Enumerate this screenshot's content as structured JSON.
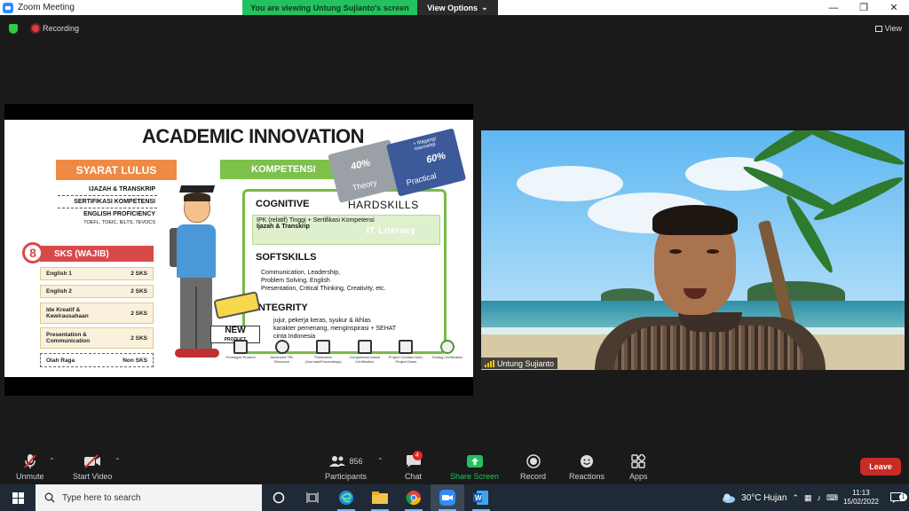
{
  "window": {
    "title": "Zoom Meeting"
  },
  "share_banner": {
    "viewing": "You are viewing Untung Sujianto's screen",
    "view_options": "View Options"
  },
  "status": {
    "recording": "Recording",
    "view": "View"
  },
  "slide": {
    "title": "ACADEMIC INNOVATION",
    "syarat_lulus": "SYARAT LULUS",
    "requirements": [
      "IJAZAH & TRANSKRIP",
      "SERTIFIKASI KOMPETENSI",
      "ENGLISH PROFICIENCY"
    ],
    "english_tests": "TOEFL, TOEIC, IELTS, TEVOCS",
    "sks_number": "8",
    "sks_label": "SKS (WAJIB)",
    "courses": [
      {
        "name": "English 1",
        "sks": "2 SKS"
      },
      {
        "name": "English 2",
        "sks": "2 SKS"
      },
      {
        "name": "Ide Kreatif & Kewirausahaan",
        "sks": "2 SKS"
      },
      {
        "name": "Presentation & Communication",
        "sks": "2 SKS"
      },
      {
        "name": "Olah Raga",
        "sks": "Non SKS"
      }
    ],
    "kompetensi": "KOMPETENSI",
    "theory_pct": "40%",
    "theory_label": "Theory",
    "practical_pct": "60%",
    "practical_label": "Practical",
    "magang": "+ Magang/ Internship",
    "cognitive": "COGNITIVE",
    "hardskills": "HARDSKILLS",
    "cognitive_line1": "IPK (relatif) Tinggi + Sertifikasi Kompetensi",
    "cognitive_line2": "Ijazah & Transkrip",
    "it_literacy": "IT  Literacy",
    "softskills": "SOFTSKILLS",
    "soft_line1": "Communication, Leadership,",
    "soft_line2": "Problem Solving, English",
    "soft_line3": "Presentation, Critical Thinking, Creativity, etc.",
    "integrity": "INTEGRITY",
    "integ_line1": "jujur, pekerja keras, syukur & ikhlas",
    "integ_line2": "karakter pemenang, menginspirasi + SEHAT",
    "integ_line3": "cinta Indonesia",
    "new_label": "NEW",
    "product_label": "PRODUCT",
    "bottom_icons": [
      "Prototype/ Product",
      "Advanced TRL Research",
      "Publication (Journals/Proceedings)",
      "Competence-based Certification",
      "Project Contract MoU, Project Deals",
      "Testing Certification"
    ]
  },
  "video": {
    "participant_name": "Untung Sujianto"
  },
  "toolbar": {
    "unmute": "Unmute",
    "start_video": "Start Video",
    "participants": "Participants",
    "participant_count": "856",
    "chat": "Chat",
    "chat_badge": "4",
    "share_screen": "Share Screen",
    "record": "Record",
    "reactions": "Reactions",
    "apps": "Apps",
    "leave": "Leave"
  },
  "taskbar": {
    "search_placeholder": "Type here to search",
    "weather": "30°C  Hujan",
    "time": "11:13",
    "date": "15/02/2022",
    "notification_count": "1"
  },
  "colors": {
    "zoom_blue": "#2d8cff",
    "share_green": "#23c25e",
    "leave_red": "#c92b25",
    "taskbar": "#1f2a36"
  }
}
